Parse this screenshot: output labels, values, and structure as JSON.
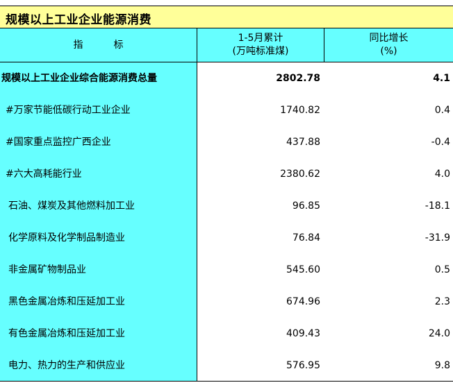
{
  "title": "规模以上工业企业能源消费",
  "header": {
    "indicator": "指标",
    "cumulative_line1": "1-5月累计",
    "cumulative_line2": "(万吨标准煤)",
    "yoy_line1": "同比增长",
    "yoy_line2": "(%)"
  },
  "rows": [
    {
      "name": "规模以上工业企业综合能源消费总量",
      "value": "2802.78",
      "growth": "4.1"
    },
    {
      "name": "  #万家节能低碳行动工业企业",
      "value": "1740.82",
      "growth": "0.4"
    },
    {
      "name": "  #国家重点监控广西企业",
      "value": "437.88",
      "growth": "-0.4"
    },
    {
      "name": "  #六大高耗能行业",
      "value": "2380.62",
      "growth": "4.0"
    },
    {
      "name": "    石油、煤炭及其他燃料加工业",
      "value": "96.85",
      "growth": "-18.1"
    },
    {
      "name": "    化学原料及化学制品制造业",
      "value": "76.84",
      "growth": "-31.9"
    },
    {
      "name": "    非金属矿物制品业",
      "value": "545.60",
      "growth": "0.5"
    },
    {
      "name": "    黑色金属冶炼和压延加工业",
      "value": "674.96",
      "growth": "2.3"
    },
    {
      "name": "    有色金属冶炼和压延加工业",
      "value": "409.43",
      "growth": "24.0"
    },
    {
      "name": "    电力、热力的生产和供应业",
      "value": "576.95",
      "growth": "9.8"
    }
  ]
}
